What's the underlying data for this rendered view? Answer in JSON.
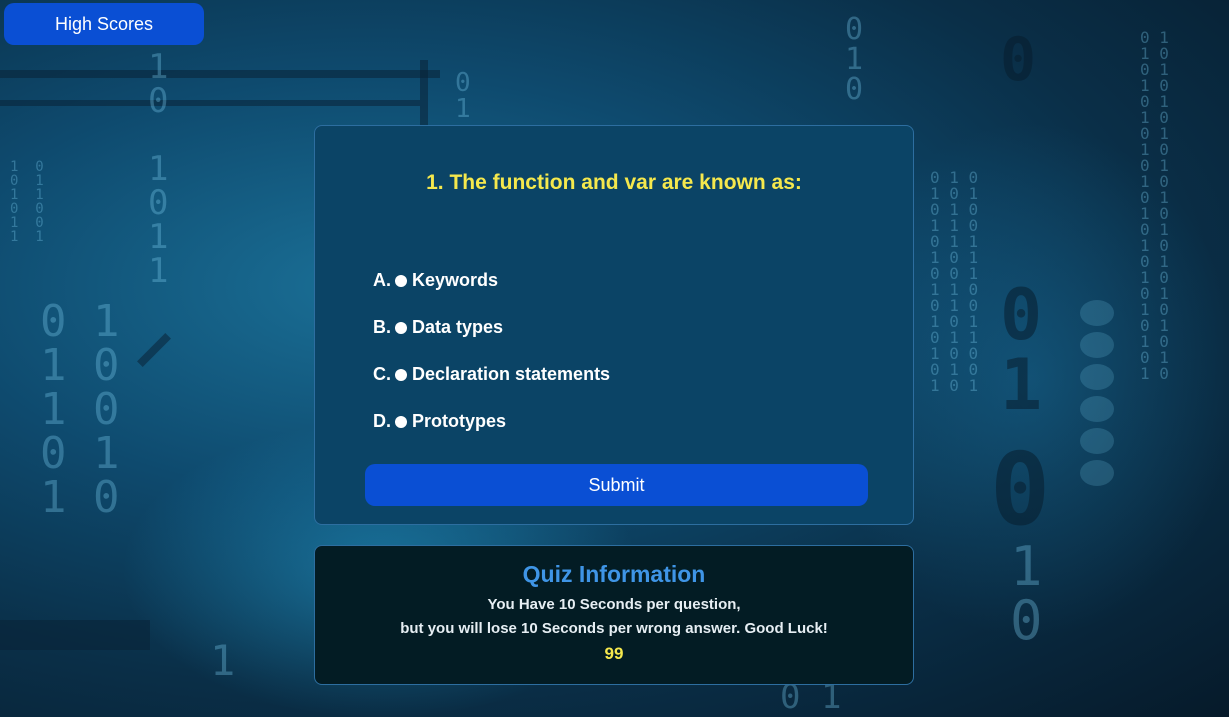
{
  "header": {
    "high_scores_label": "High Scores"
  },
  "quiz": {
    "question": "1. The function and var are known as:",
    "options": [
      {
        "letter": "A.",
        "text": "Keywords"
      },
      {
        "letter": "B.",
        "text": "Data types"
      },
      {
        "letter": "C.",
        "text": "Declaration statements"
      },
      {
        "letter": "D.",
        "text": "Prototypes"
      }
    ],
    "submit_label": "Submit"
  },
  "info": {
    "title": "Quiz Information",
    "line1": "You Have 10 Seconds per question,",
    "line2": "but you will lose 10 Seconds per wrong answer. Good Luck!",
    "timer": "99"
  },
  "colors": {
    "button_blue": "#0a4fd4",
    "question_yellow": "#f5e84d",
    "info_title_blue": "#3f95e6",
    "card_bg": "#0b4466",
    "info_bg": "#031c24"
  }
}
